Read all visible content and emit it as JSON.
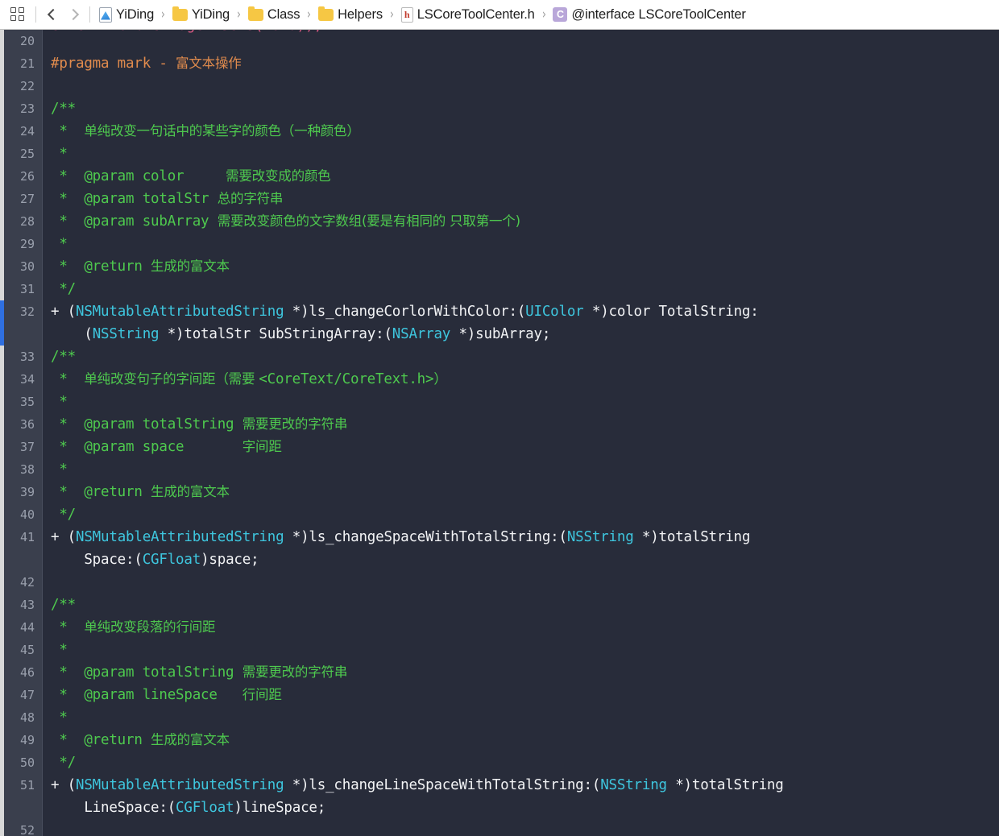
{
  "window": {
    "title": "LSCoreToolCenter.h",
    "background": "#282c3a",
    "gutter_background": "#3a3f4d",
    "accent_marker": "#2f6fe0"
  },
  "jumpbar": {
    "related_items_label": "Related Items",
    "back_label": "Back",
    "forward_label": "Forward",
    "breadcrumbs": [
      {
        "label": "YiDing",
        "icon": "project-icon",
        "type": "project"
      },
      {
        "label": "YiDing",
        "icon": "folder-icon",
        "type": "folder"
      },
      {
        "label": "Class",
        "icon": "folder-icon",
        "type": "folder"
      },
      {
        "label": "Helpers",
        "icon": "folder-icon",
        "type": "folder"
      },
      {
        "label": "LSCoreToolCenter.h",
        "icon": "header-file-icon",
        "type": "file",
        "badge": "h"
      },
      {
        "label": "@interface LSCoreToolCenter",
        "icon": "interface-symbol-icon",
        "type": "symbol",
        "badge": "C"
      }
    ],
    "separator": "›"
  },
  "editor": {
    "clipped_line_above": "extern void UIEdgeInsets(void));",
    "first_visible_line": 20,
    "last_visible_line": 52,
    "syntax_colors": {
      "comment": "#4ec94e",
      "preprocessor": "#e08b4d",
      "type": "#3ec6de",
      "plain": "#f2f3f5",
      "keyword": "#f2628f",
      "line_number": "#9aa0ad"
    },
    "lines": [
      {
        "n": 20,
        "segments": []
      },
      {
        "n": 21,
        "segments": [
          {
            "t": "#pragma mark - ",
            "c": "pragma"
          },
          {
            "t": "富文本操作",
            "c": "pragma",
            "cjk": true
          }
        ]
      },
      {
        "n": 22,
        "segments": []
      },
      {
        "n": 23,
        "segments": [
          {
            "t": "/**",
            "c": "comment"
          }
        ]
      },
      {
        "n": 24,
        "segments": [
          {
            "t": " *  ",
            "c": "comment"
          },
          {
            "t": "单纯改变一句话中的某些字的颜色（一种颜色）",
            "c": "comment",
            "cjk": true
          }
        ]
      },
      {
        "n": 25,
        "segments": [
          {
            "t": " *",
            "c": "comment"
          }
        ]
      },
      {
        "n": 26,
        "segments": [
          {
            "t": " *  @param color     ",
            "c": "comment"
          },
          {
            "t": "需要改变成的颜色",
            "c": "comment",
            "cjk": true
          }
        ]
      },
      {
        "n": 27,
        "segments": [
          {
            "t": " *  @param totalStr ",
            "c": "comment"
          },
          {
            "t": "总的字符串",
            "c": "comment",
            "cjk": true
          }
        ]
      },
      {
        "n": 28,
        "segments": [
          {
            "t": " *  @param subArray ",
            "c": "comment"
          },
          {
            "t": "需要改变颜色的文字数组(要是有相同的 只取第一个)",
            "c": "comment",
            "cjk": true
          }
        ]
      },
      {
        "n": 29,
        "segments": [
          {
            "t": " *",
            "c": "comment"
          }
        ]
      },
      {
        "n": 30,
        "segments": [
          {
            "t": " *  @return ",
            "c": "comment"
          },
          {
            "t": "生成的富文本",
            "c": "comment",
            "cjk": true
          }
        ]
      },
      {
        "n": 31,
        "segments": [
          {
            "t": " */",
            "c": "comment"
          }
        ]
      },
      {
        "n": 32,
        "segments": [
          {
            "t": "+ (",
            "c": "plain"
          },
          {
            "t": "NSMutableAttributedString",
            "c": "type"
          },
          {
            "t": " *)ls_changeCorlorWithColor:(",
            "c": "plain"
          },
          {
            "t": "UIColor",
            "c": "type"
          },
          {
            "t": " *)color TotalString:",
            "c": "plain"
          }
        ],
        "continuation": [
          {
            "t": "    (",
            "c": "plain"
          },
          {
            "t": "NSString",
            "c": "type"
          },
          {
            "t": " *)totalStr SubStringArray:(",
            "c": "plain"
          },
          {
            "t": "NSArray",
            "c": "type"
          },
          {
            "t": " *)subArray;",
            "c": "plain"
          }
        ],
        "changed": true
      },
      {
        "n": 33,
        "segments": [
          {
            "t": "/**",
            "c": "comment"
          }
        ]
      },
      {
        "n": 34,
        "segments": [
          {
            "t": " *  ",
            "c": "comment"
          },
          {
            "t": "单纯改变句子的字间距（需要 ",
            "c": "comment",
            "cjk": true
          },
          {
            "t": "<CoreText/CoreText.h>",
            "c": "comment"
          },
          {
            "t": "）",
            "c": "comment",
            "cjk": true
          }
        ]
      },
      {
        "n": 35,
        "segments": [
          {
            "t": " *",
            "c": "comment"
          }
        ]
      },
      {
        "n": 36,
        "segments": [
          {
            "t": " *  @param totalString ",
            "c": "comment"
          },
          {
            "t": "需要更改的字符串",
            "c": "comment",
            "cjk": true
          }
        ]
      },
      {
        "n": 37,
        "segments": [
          {
            "t": " *  @param space       ",
            "c": "comment"
          },
          {
            "t": "字间距",
            "c": "comment",
            "cjk": true
          }
        ]
      },
      {
        "n": 38,
        "segments": [
          {
            "t": " *",
            "c": "comment"
          }
        ]
      },
      {
        "n": 39,
        "segments": [
          {
            "t": " *  @return ",
            "c": "comment"
          },
          {
            "t": "生成的富文本",
            "c": "comment",
            "cjk": true
          }
        ]
      },
      {
        "n": 40,
        "segments": [
          {
            "t": " */",
            "c": "comment"
          }
        ]
      },
      {
        "n": 41,
        "segments": [
          {
            "t": "+ (",
            "c": "plain"
          },
          {
            "t": "NSMutableAttributedString",
            "c": "type"
          },
          {
            "t": " *)ls_changeSpaceWithTotalString:(",
            "c": "plain"
          },
          {
            "t": "NSString",
            "c": "type"
          },
          {
            "t": " *)totalString",
            "c": "plain"
          }
        ],
        "continuation": [
          {
            "t": "    Space:(",
            "c": "plain"
          },
          {
            "t": "CGFloat",
            "c": "type"
          },
          {
            "t": ")space;",
            "c": "plain"
          }
        ]
      },
      {
        "n": 42,
        "segments": []
      },
      {
        "n": 43,
        "segments": [
          {
            "t": "/**",
            "c": "comment"
          }
        ]
      },
      {
        "n": 44,
        "segments": [
          {
            "t": " *  ",
            "c": "comment"
          },
          {
            "t": "单纯改变段落的行间距",
            "c": "comment",
            "cjk": true
          }
        ]
      },
      {
        "n": 45,
        "segments": [
          {
            "t": " *",
            "c": "comment"
          }
        ]
      },
      {
        "n": 46,
        "segments": [
          {
            "t": " *  @param totalString ",
            "c": "comment"
          },
          {
            "t": "需要更改的字符串",
            "c": "comment",
            "cjk": true
          }
        ]
      },
      {
        "n": 47,
        "segments": [
          {
            "t": " *  @param lineSpace   ",
            "c": "comment"
          },
          {
            "t": "行间距",
            "c": "comment",
            "cjk": true
          }
        ]
      },
      {
        "n": 48,
        "segments": [
          {
            "t": " *",
            "c": "comment"
          }
        ]
      },
      {
        "n": 49,
        "segments": [
          {
            "t": " *  @return ",
            "c": "comment"
          },
          {
            "t": "生成的富文本",
            "c": "comment",
            "cjk": true
          }
        ]
      },
      {
        "n": 50,
        "segments": [
          {
            "t": " */",
            "c": "comment"
          }
        ]
      },
      {
        "n": 51,
        "segments": [
          {
            "t": "+ (",
            "c": "plain"
          },
          {
            "t": "NSMutableAttributedString",
            "c": "type"
          },
          {
            "t": " *)ls_changeLineSpaceWithTotalString:(",
            "c": "plain"
          },
          {
            "t": "NSString",
            "c": "type"
          },
          {
            "t": " *)totalString",
            "c": "plain"
          }
        ],
        "continuation": [
          {
            "t": "    LineSpace:(",
            "c": "plain"
          },
          {
            "t": "CGFloat",
            "c": "type"
          },
          {
            "t": ")lineSpace;",
            "c": "plain"
          }
        ]
      },
      {
        "n": 52,
        "segments": []
      }
    ]
  }
}
